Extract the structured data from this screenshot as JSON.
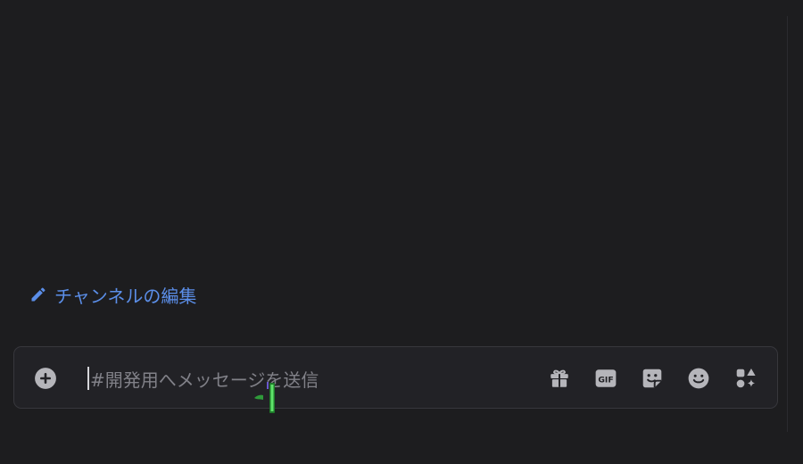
{
  "channel": {
    "edit_label": "チャンネルの編集"
  },
  "composer": {
    "placeholder": "#開発用へメッセージを送信",
    "icons": {
      "attach": "plus-circle-icon",
      "gift": "gift-icon",
      "gif": "gif-icon",
      "sticker": "sticker-icon",
      "emoji": "emoji-icon",
      "apps": "apps-icon"
    },
    "gif_label": "GIF"
  },
  "colors": {
    "background": "#1d1d1f",
    "composer_bg": "#222226",
    "link": "#5b8ee8",
    "icon": "#b5b5ba",
    "placeholder": "#818188"
  }
}
